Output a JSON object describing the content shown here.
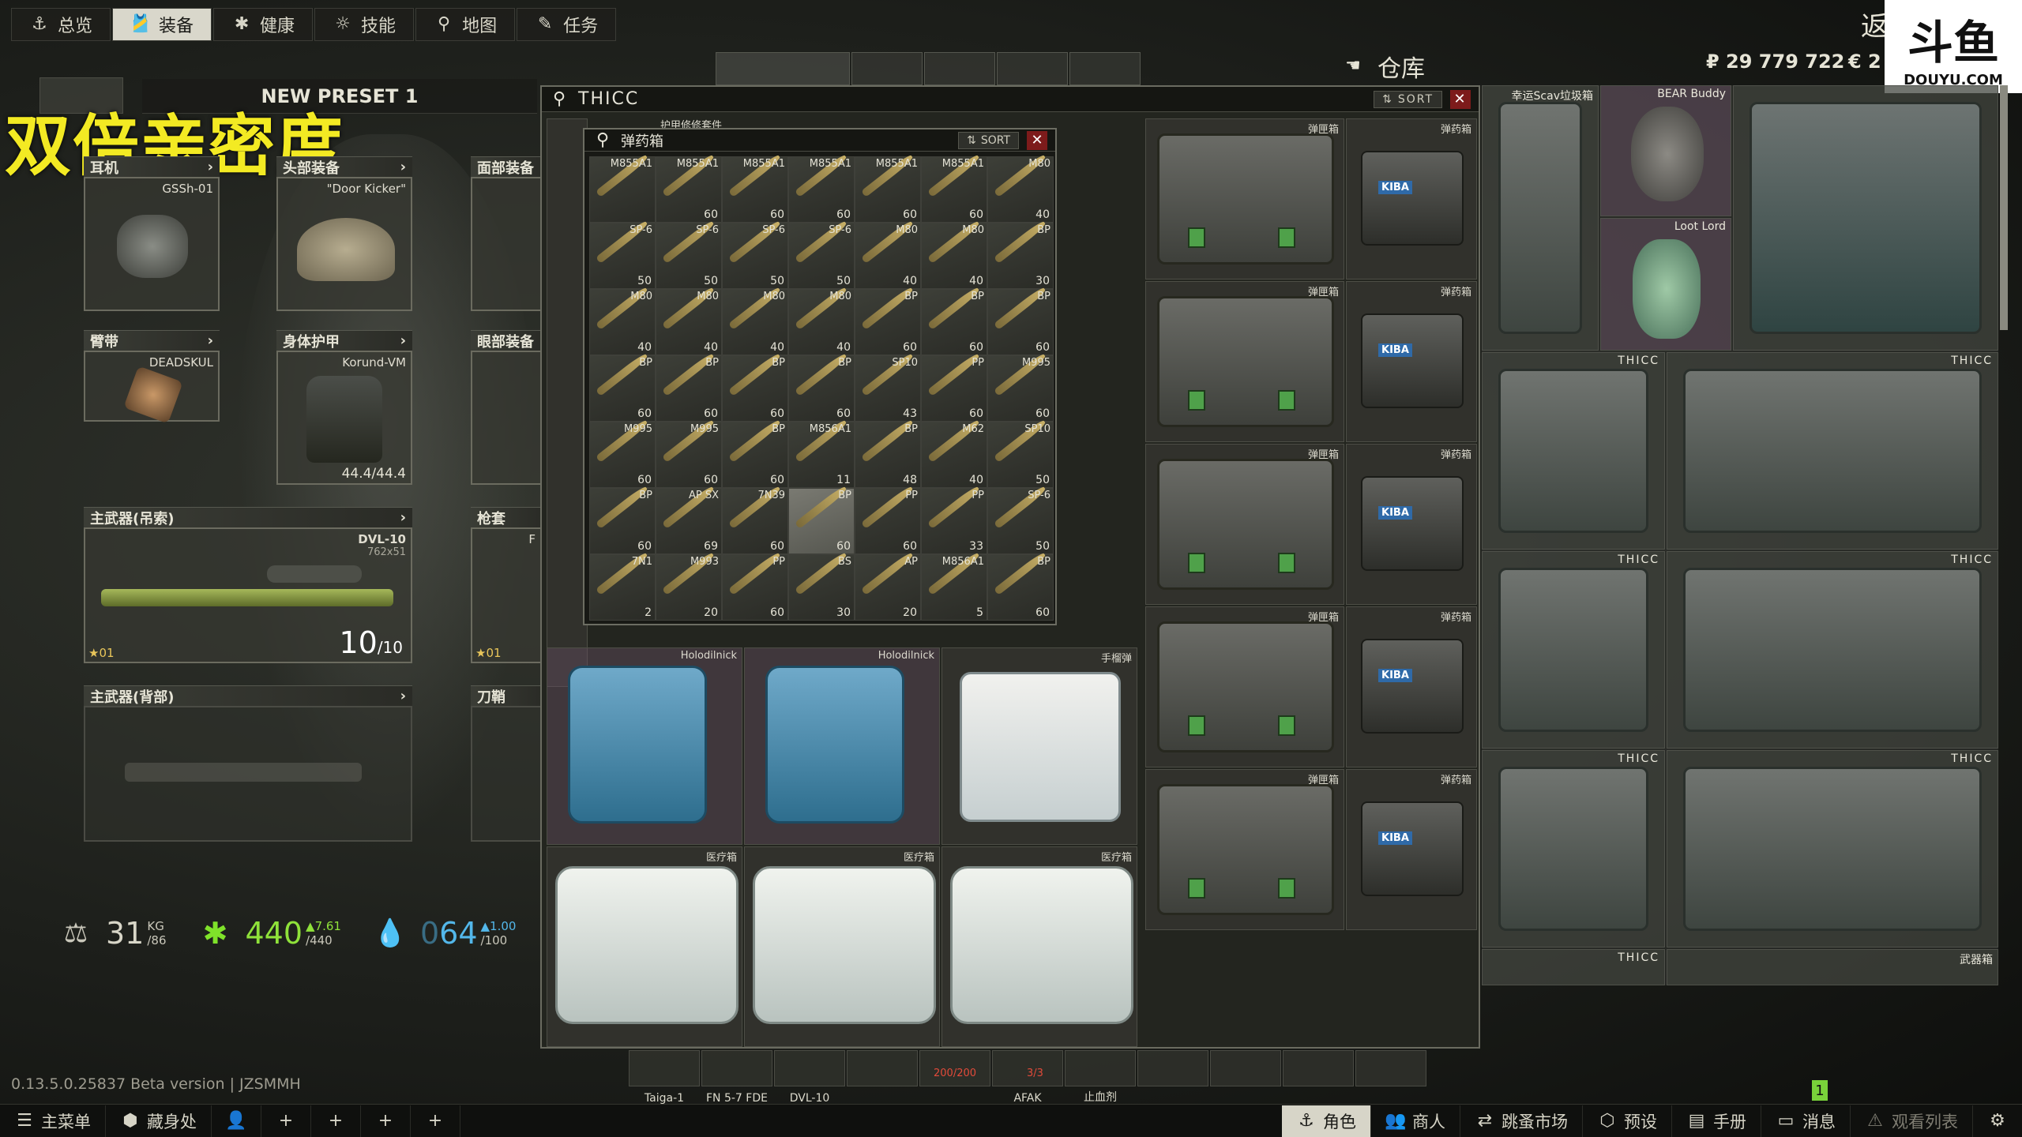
{
  "topnav": {
    "tabs": [
      {
        "label": "总览",
        "icon": "anchor-icon"
      },
      {
        "label": "装备",
        "icon": "gear-equipment-icon",
        "active": true
      },
      {
        "label": "健康",
        "icon": "health-icon"
      },
      {
        "label": "技能",
        "icon": "skills-icon"
      },
      {
        "label": "地图",
        "icon": "map-pin-icon"
      },
      {
        "label": "任务",
        "icon": "tasks-icon"
      }
    ]
  },
  "header": {
    "back_label": "返",
    "stash_title": "仓库",
    "roubles": "₽ 29 779 722",
    "euros": "€ 2",
    "logo_text": "斗鱼",
    "logo_sub": "DOUYU.COM"
  },
  "watermark": {
    "text": "双倍亲密度"
  },
  "preset": {
    "name": "NEW PRESET 1"
  },
  "equipment": {
    "earpiece": {
      "label": "耳机",
      "item": "GSSh-01"
    },
    "headwear": {
      "label": "头部装备",
      "item": "\"Door Kicker\""
    },
    "facecover": {
      "label": "面部装备"
    },
    "armband": {
      "label": "臂带",
      "item": "DEADSKUL"
    },
    "body_armor": {
      "label": "身体护甲",
      "item": "Korund-VM",
      "durability": "44.4/44.4"
    },
    "eyewear": {
      "label": "眼部装备"
    },
    "primary_sling": {
      "label": "主武器(吊索)",
      "item": "DVL-10",
      "caliber": "762x51",
      "ammo": "10",
      "ammo_max": "/10",
      "level": "01"
    },
    "holster": {
      "label": "枪套",
      "item": "F",
      "level": "01"
    },
    "primary_back": {
      "label": "主武器(背部)"
    },
    "scabbard": {
      "label": "刀鞘"
    }
  },
  "stats": {
    "weight": "31",
    "weight_unit": "KG",
    "weight_max": "/86",
    "health": "440",
    "health_max": "/440",
    "health_regen": "▲7.61",
    "hydration": "64",
    "hydration_prefix": "0",
    "hydration_max": "/100",
    "hydration_regen": "▲1.00"
  },
  "version": "0.13.5.0.25837 Beta version | JZSMMH",
  "thicc_window": {
    "title": "THICC",
    "sort_label": "SORT",
    "sub_header": "护甲修修套件",
    "ammo_window": {
      "title": "弹药箱",
      "sort_label": "SORT",
      "cells": [
        {
          "t": "M855A1",
          "c": ""
        },
        {
          "t": "M855A1",
          "c": "60"
        },
        {
          "t": "M855A1",
          "c": "60"
        },
        {
          "t": "M855A1",
          "c": "60"
        },
        {
          "t": "M855A1",
          "c": "60"
        },
        {
          "t": "M855A1",
          "c": "60"
        },
        {
          "t": "M80",
          "c": "40"
        },
        {
          "t": "SP-6",
          "c": "50"
        },
        {
          "t": "SP-6",
          "c": "50"
        },
        {
          "t": "SP-6",
          "c": "50"
        },
        {
          "t": "SP-6",
          "c": "50"
        },
        {
          "t": "M80",
          "c": "40"
        },
        {
          "t": "M80",
          "c": "40"
        },
        {
          "t": "BP",
          "c": "30"
        },
        {
          "t": "M80",
          "c": "40"
        },
        {
          "t": "M80",
          "c": "40"
        },
        {
          "t": "M80",
          "c": "40"
        },
        {
          "t": "M80",
          "c": "40"
        },
        {
          "t": "BP",
          "c": "60"
        },
        {
          "t": "BP",
          "c": "60"
        },
        {
          "t": "BP",
          "c": "60"
        },
        {
          "t": "BP",
          "c": "60"
        },
        {
          "t": "BP",
          "c": "60"
        },
        {
          "t": "BP",
          "c": "60"
        },
        {
          "t": "BP",
          "c": "60"
        },
        {
          "t": "SP10",
          "c": "43"
        },
        {
          "t": "PP",
          "c": "60"
        },
        {
          "t": "M995",
          "c": "60"
        },
        {
          "t": "M995",
          "c": "60"
        },
        {
          "t": "M995",
          "c": "60"
        },
        {
          "t": "BP",
          "c": "60"
        },
        {
          "t": "M856A1",
          "c": "11"
        },
        {
          "t": "BP",
          "c": "48"
        },
        {
          "t": "M62",
          "c": "40"
        },
        {
          "t": "SP10",
          "c": "50"
        },
        {
          "t": "BP",
          "c": "60"
        },
        {
          "t": "AP SX",
          "c": "69"
        },
        {
          "t": "7N39",
          "c": "60"
        },
        {
          "t": "BP",
          "c": "60"
        },
        {
          "t": "PP",
          "c": "60"
        },
        {
          "t": "PP",
          "c": "33"
        },
        {
          "t": "SP-6",
          "c": "50"
        },
        {
          "t": "7N1",
          "c": "2"
        },
        {
          "t": "M993",
          "c": "20"
        },
        {
          "t": "PP",
          "c": "60"
        },
        {
          "t": "BS",
          "c": "30"
        },
        {
          "t": "AP",
          "c": "20"
        },
        {
          "t": "M856A1",
          "c": "5"
        },
        {
          "t": "BP",
          "c": "60"
        }
      ]
    },
    "ammo_case_label": "弹匣箱",
    "ammo_can_label": "弹药箱",
    "grenade_label": "手榴弹",
    "cooler_label": "Holodilnick",
    "med_label": "医疗箱"
  },
  "stash": {
    "scav_junk": "幸运Scav垃圾箱",
    "bear_buddy": "BEAR Buddy",
    "loot_lord": "Loot Lord",
    "thicc": "THICC",
    "weapon_case": "武器箱"
  },
  "quickbar": [
    "Taiga-1",
    "FN 5-7 FDE",
    "DVL-10",
    "",
    "",
    "AFAK",
    "止血剂"
  ],
  "quickbar_values": {
    "afak": "200/200",
    "tourniquet": "3/3"
  },
  "bottombar": {
    "left": [
      {
        "label": "主菜单",
        "icon": "menu-icon"
      },
      {
        "label": "藏身处",
        "icon": "hideout-icon"
      }
    ],
    "right": [
      {
        "label": "角色",
        "icon": "character-icon",
        "active": true
      },
      {
        "label": "商人",
        "icon": "traders-icon"
      },
      {
        "label": "跳蚤市场",
        "icon": "flea-icon"
      },
      {
        "label": "预设",
        "icon": "preset-icon"
      },
      {
        "label": "手册",
        "icon": "handbook-icon"
      },
      {
        "label": "消息",
        "icon": "messages-icon"
      },
      {
        "label": "观看列表",
        "icon": "watchlist-icon"
      }
    ],
    "badge": "1"
  }
}
